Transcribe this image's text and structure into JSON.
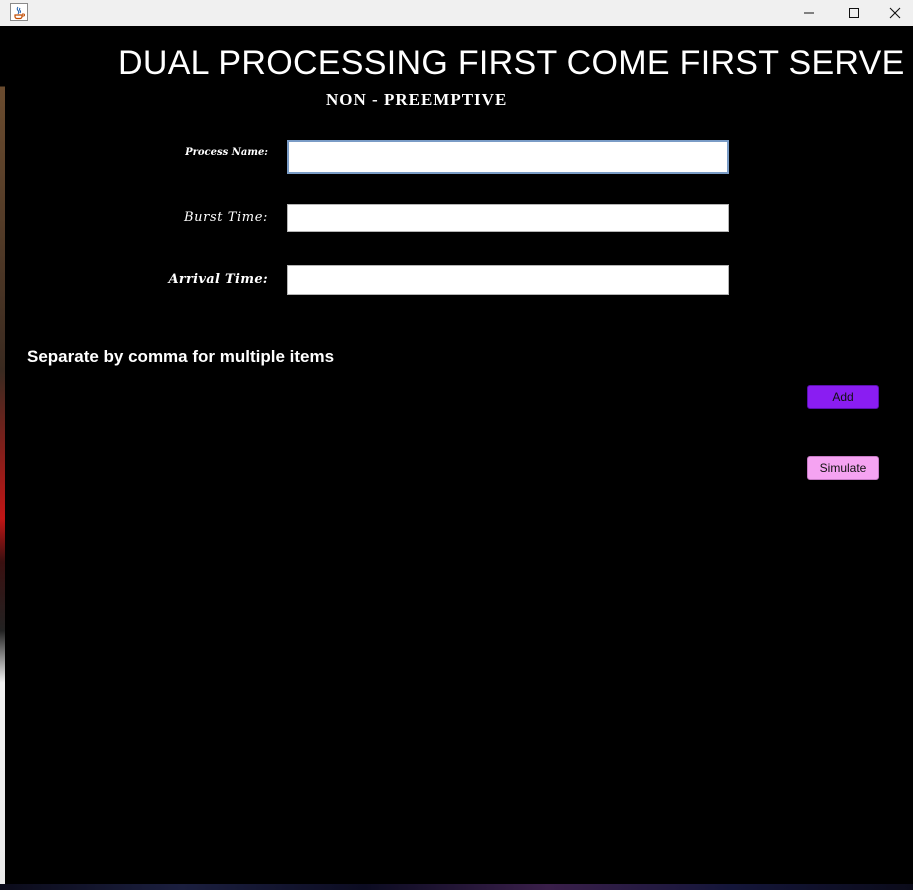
{
  "window": {
    "title_bar": {
      "app_icon": "java-cup-icon",
      "controls": {
        "minimize_icon": "minimize-icon",
        "maximize_icon": "maximize-icon",
        "close_icon": "close-icon"
      }
    }
  },
  "main": {
    "title": "DUAL PROCESSING FIRST COME FIRST SERVE",
    "subtitle": "NON - PREEMPTIVE",
    "form": {
      "process_name_label": "Process Name:",
      "process_name_value": "",
      "burst_time_label": "Burst Time:",
      "burst_time_value": "",
      "arrival_time_label": "Arrival Time:",
      "arrival_time_value": ""
    },
    "hint": "Separate by comma for multiple items",
    "buttons": {
      "add_label": "Add",
      "simulate_label": "Simulate"
    }
  },
  "colors": {
    "background": "#000000",
    "add_button": "#8a1df2",
    "simulate_button": "#f5a3f2",
    "text": "#ffffff"
  }
}
